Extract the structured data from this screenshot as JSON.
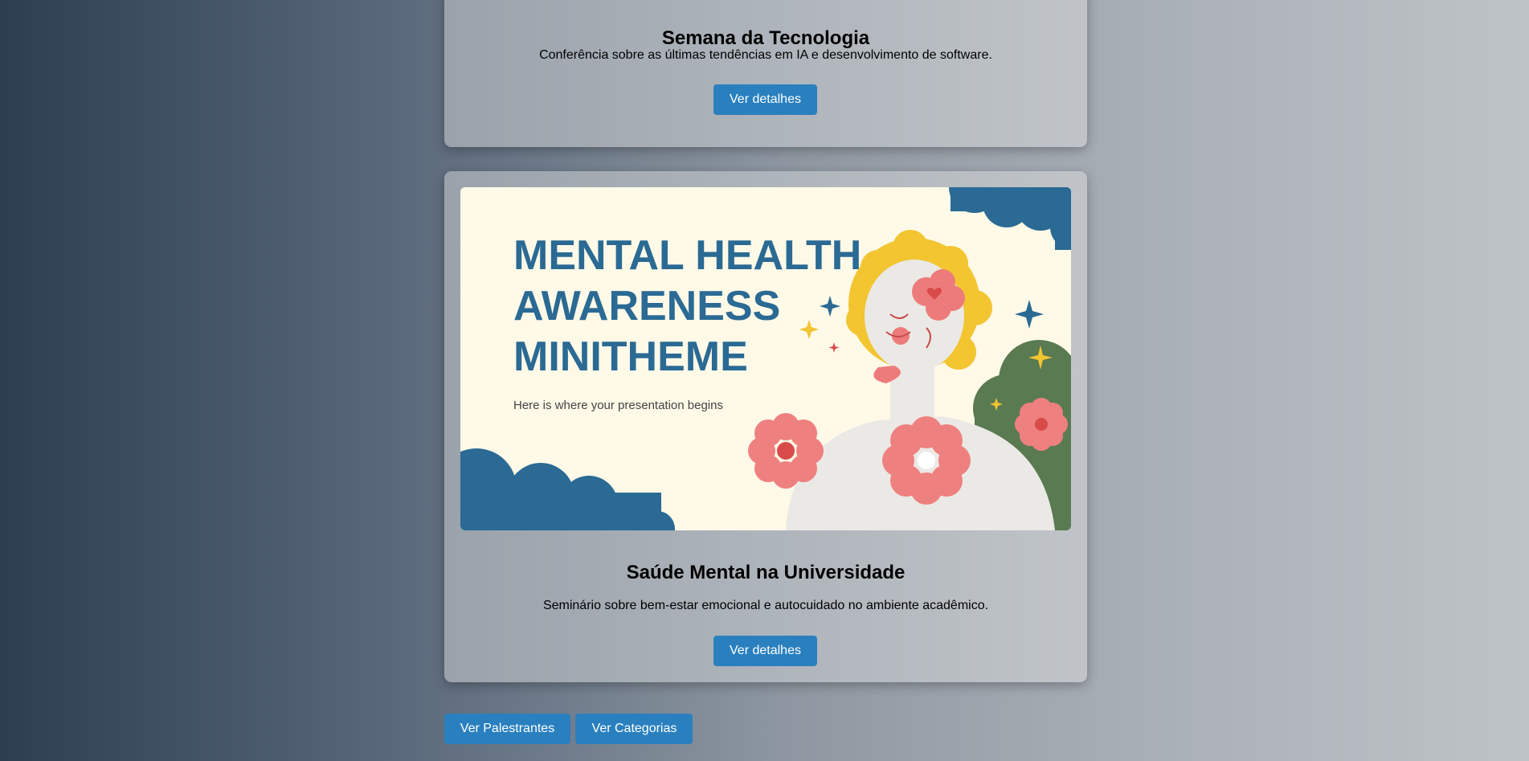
{
  "events": [
    {
      "title": "Semana da Tecnologia",
      "description": "Conferência sobre as últimas tendências em IA e desenvolvimento de software.",
      "button_label": "Ver detalhes"
    },
    {
      "title": "Saúde Mental na Universidade",
      "description": "Seminário sobre bem-estar emocional e autocuidado no ambiente acadêmico.",
      "button_label": "Ver detalhes",
      "banner": {
        "line1": "MENTAL HEALTH",
        "line2": "AWARENESS",
        "line3": "MINITHEME",
        "subtitle": "Here is where your presentation begins"
      }
    }
  ],
  "actions": {
    "speakers_label": "Ver Palestrantes",
    "categories_label": "Ver Categorias"
  },
  "colors": {
    "button": "#2a80bf",
    "banner_title": "#2a6a94",
    "banner_bg": "#fff9e8"
  }
}
